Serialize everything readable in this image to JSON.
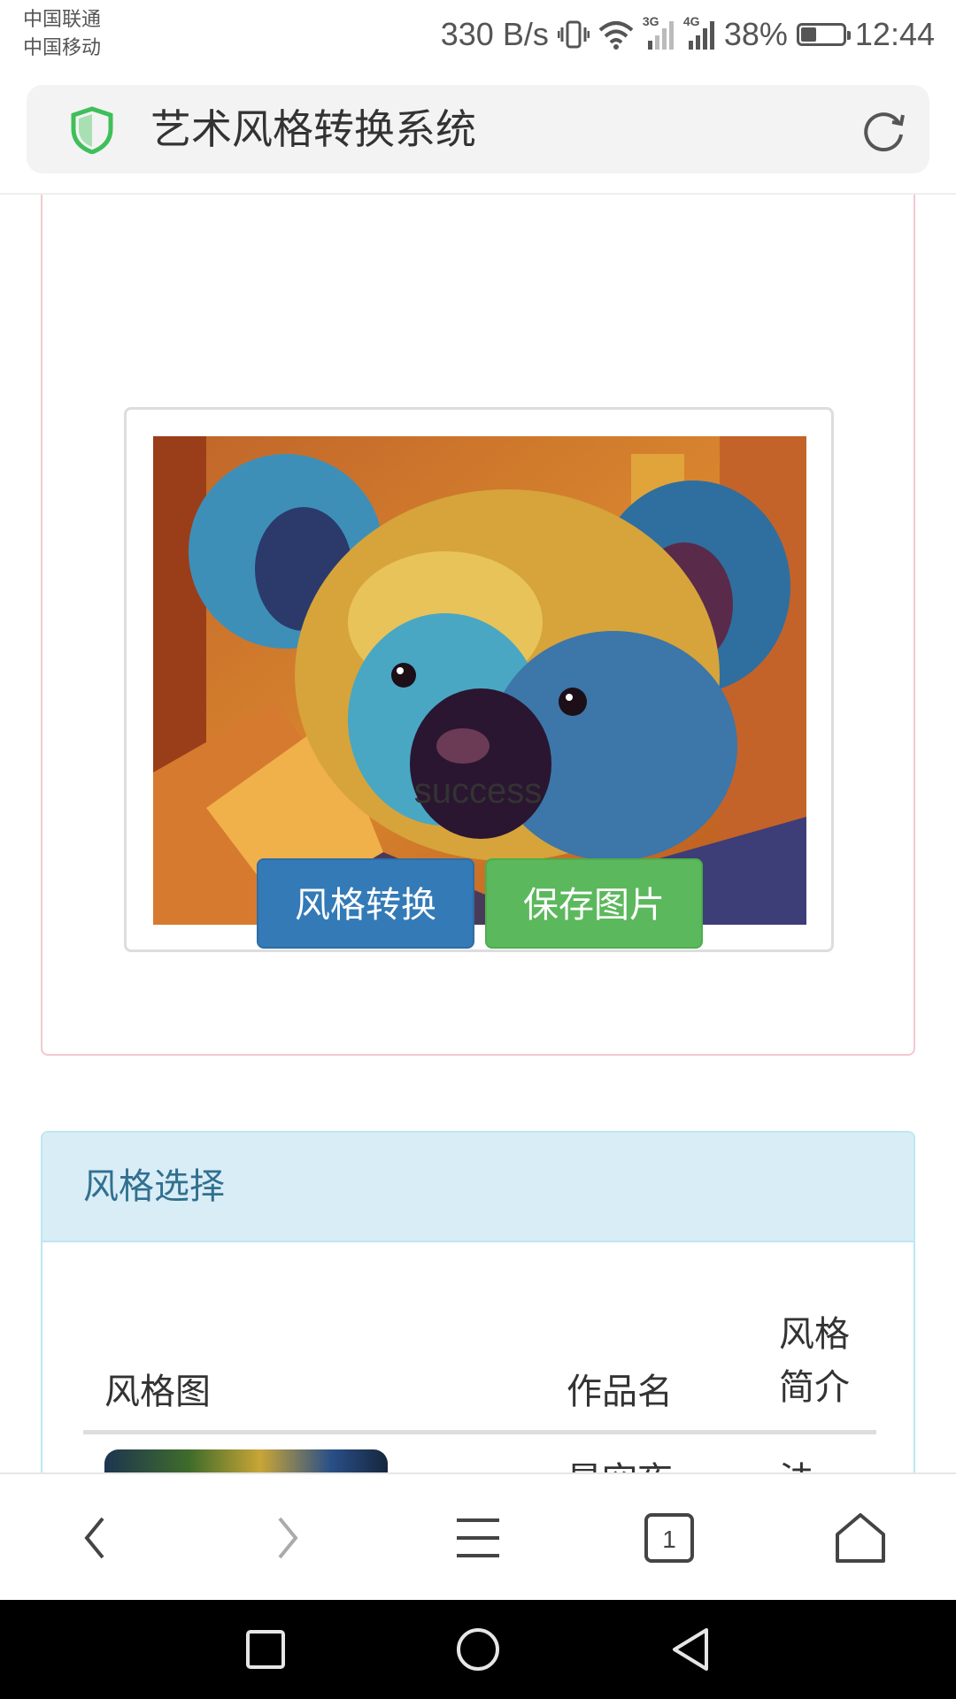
{
  "status_bar": {
    "carrier_1": "中国联通",
    "carrier_2": "中国移动",
    "net_speed": "330 B/s",
    "battery_percent": "38%",
    "battery_level": 0.38,
    "time": "12:44",
    "signal_3g": "3G",
    "signal_4g": "4G"
  },
  "browser": {
    "title": "艺术风格转换系统",
    "tab_count": "1"
  },
  "result": {
    "status_text": "success",
    "convert_button": "风格转换",
    "save_button": "保存图片"
  },
  "style_panel": {
    "title": "风格选择",
    "columns": [
      "风格图",
      "作品名",
      "风格简介"
    ],
    "rows": [
      {
        "name": "星空夜",
        "desc": "法"
      }
    ]
  },
  "colors": {
    "primary": "#337ab7",
    "success": "#5cb85c",
    "panel_info": "#d9edf7",
    "panel_info_border": "#bce8f1",
    "panel_result_border": "#f2c9d0"
  }
}
